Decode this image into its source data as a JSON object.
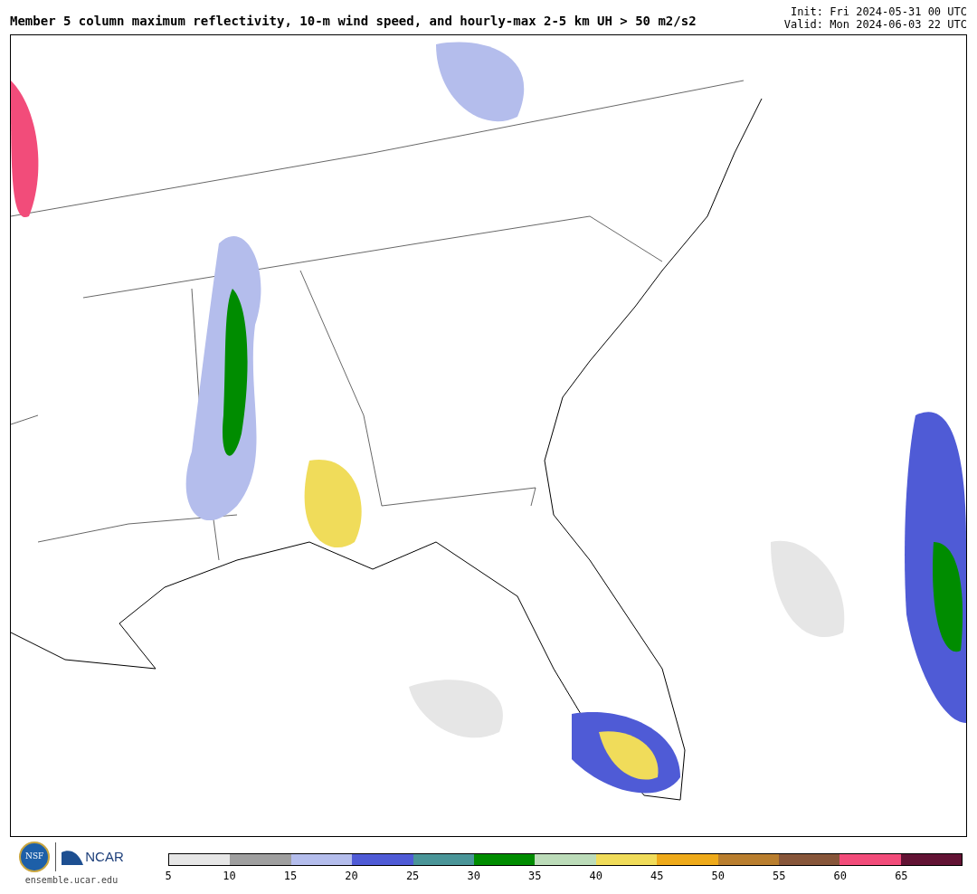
{
  "title": "Member 5 column maximum reflectivity, 10-m wind speed, and hourly-max 2-5 km UH > 50 m2/s2",
  "init": "Init: Fri 2024-05-31 00 UTC",
  "valid": "Valid: Mon 2024-06-03 22 UTC",
  "logos": {
    "nsf": "NSF",
    "ncar": "NCAR"
  },
  "website": "ensemble.ucar.edu",
  "colorbar": {
    "segments": [
      {
        "color": "#e6e6e6",
        "label": "5"
      },
      {
        "color": "#9f9f9f",
        "label": "10"
      },
      {
        "color": "#b4bdec",
        "label": "15"
      },
      {
        "color": "#4f5bd6",
        "label": "20"
      },
      {
        "color": "#4a9598",
        "label": "25"
      },
      {
        "color": "#008c00",
        "label": "30"
      },
      {
        "color": "#bcdcb9",
        "label": "35"
      },
      {
        "color": "#f0dc5a",
        "label": "40"
      },
      {
        "color": "#eeaa1a",
        "label": "45"
      },
      {
        "color": "#b97e2e",
        "label": "50"
      },
      {
        "color": "#87563a",
        "label": "55"
      },
      {
        "color": "#f24c7a",
        "label": "60"
      },
      {
        "color": "#621334",
        "label": "65"
      }
    ]
  }
}
